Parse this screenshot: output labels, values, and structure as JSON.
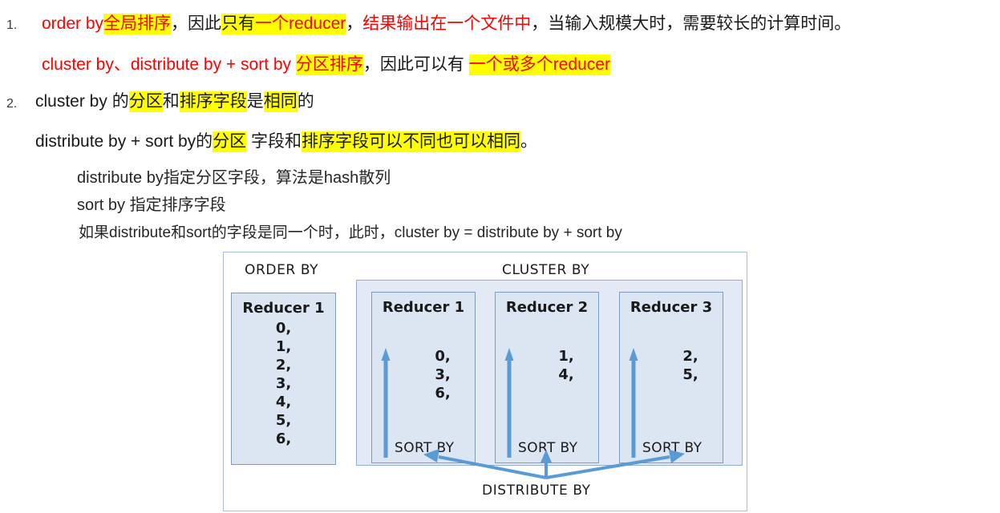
{
  "notes": {
    "item1": {
      "marker": "1.",
      "line1": [
        {
          "text": "order by",
          "color": "red",
          "highlight": false
        },
        {
          "text": "全局排序",
          "color": "red",
          "highlight": true
        },
        {
          "text": "，因此",
          "color": "black",
          "highlight": false
        },
        {
          "text": "只有",
          "color": "black",
          "highlight": true
        },
        {
          "text": "一个reducer",
          "color": "red",
          "highlight": true
        },
        {
          "text": "，",
          "color": "black",
          "highlight": false
        },
        {
          "text": "结果输出在一个文件中",
          "color": "red",
          "highlight": false
        },
        {
          "text": "，当输入规模大时，需要较长的计算时间。",
          "color": "black",
          "highlight": false
        }
      ],
      "line2": [
        {
          "text": "cluster by、distribute by + sort by ",
          "color": "red",
          "highlight": false
        },
        {
          "text": "分区排序",
          "color": "red",
          "highlight": true
        },
        {
          "text": "，因此可以有 ",
          "color": "black",
          "highlight": false
        },
        {
          "text": "一个或多个reducer",
          "color": "red",
          "highlight": true
        }
      ]
    },
    "item2": {
      "marker": "2.",
      "line1": [
        {
          "text": "cluster by 的",
          "color": "black",
          "highlight": false
        },
        {
          "text": "分区",
          "color": "black",
          "highlight": true
        },
        {
          "text": "和",
          "color": "black",
          "highlight": false
        },
        {
          "text": "排序字段",
          "color": "black",
          "highlight": true
        },
        {
          "text": "是",
          "color": "black",
          "highlight": false
        },
        {
          "text": "相同",
          "color": "black",
          "highlight": true
        },
        {
          "text": "的",
          "color": "black",
          "highlight": false
        }
      ],
      "line2": [
        {
          "text": "distribute by + sort by的",
          "color": "black",
          "highlight": false
        },
        {
          "text": "分区",
          "color": "black",
          "highlight": true
        },
        {
          "text": " 字段和",
          "color": "black",
          "highlight": false
        },
        {
          "text": "排序字段可以不同也可以相同",
          "color": "black",
          "highlight": true
        },
        {
          "text": "。",
          "color": "black",
          "highlight": false
        }
      ],
      "detail1": "distribute by指定分区字段，算法是hash散列",
      "detail2": "sort by 指定排序字段",
      "detail3": "如果distribute和sort的字段是同一个时，此时，cluster by = distribute by + sort by"
    }
  },
  "diagram": {
    "order_by_label": "ORDER BY",
    "cluster_by_label": "CLUSTER BY",
    "distribute_by_label": "DISTRIBUTE BY",
    "sort_by_label": "SORT BY",
    "order_reducer": {
      "title": "Reducer 1",
      "values": [
        "0,",
        "1,",
        "2,",
        "3,",
        "4,",
        "5,",
        "6,"
      ]
    },
    "cluster_reducers": [
      {
        "title": "Reducer 1",
        "values": [
          "0,",
          "3,",
          "6,"
        ]
      },
      {
        "title": "Reducer 2",
        "values": [
          "1,",
          "4,"
        ]
      },
      {
        "title": "Reducer 3",
        "values": [
          "2,",
          "5,"
        ]
      }
    ],
    "colors": {
      "box_fill": "#dce5f2",
      "box_border": "#7f9bc4",
      "container_fill": "#e4eaf5",
      "container_border": "#90aed3",
      "outer_border": "#a8c0de",
      "arrow": "#5b9bd5",
      "highlight": "#ffff00",
      "accent_text": "#ff0000"
    }
  }
}
